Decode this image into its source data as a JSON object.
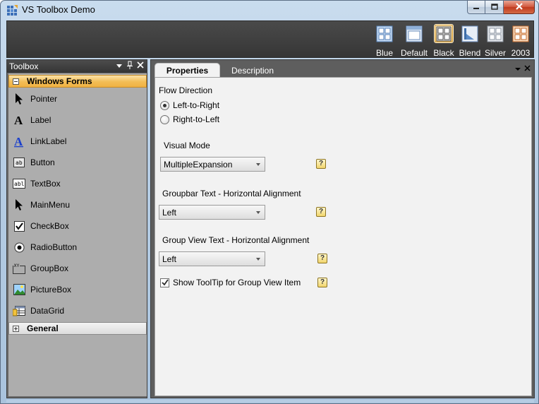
{
  "window": {
    "title": "VS Toolbox Demo"
  },
  "themes": [
    {
      "label": "Blue",
      "selected": false
    },
    {
      "label": "Default",
      "selected": false
    },
    {
      "label": "Black",
      "selected": true
    },
    {
      "label": "Blend",
      "selected": false
    },
    {
      "label": "Silver",
      "selected": false
    },
    {
      "label": "2003",
      "selected": false
    }
  ],
  "toolbox": {
    "title": "Toolbox",
    "groups": [
      {
        "label": "Windows Forms",
        "expanded": true,
        "items": [
          {
            "label": "Pointer",
            "icon": "pointer-icon"
          },
          {
            "label": "Label",
            "icon": "label-icon"
          },
          {
            "label": "LinkLabel",
            "icon": "linklabel-icon"
          },
          {
            "label": "Button",
            "icon": "button-icon"
          },
          {
            "label": "TextBox",
            "icon": "textbox-icon"
          },
          {
            "label": "MainMenu",
            "icon": "mainmenu-icon"
          },
          {
            "label": "CheckBox",
            "icon": "checkbox-icon"
          },
          {
            "label": "RadioButton",
            "icon": "radiobutton-icon"
          },
          {
            "label": "GroupBox",
            "icon": "groupbox-icon"
          },
          {
            "label": "PictureBox",
            "icon": "picturebox-icon"
          },
          {
            "label": "DataGrid",
            "icon": "datagrid-icon"
          }
        ]
      },
      {
        "label": "General",
        "expanded": false,
        "items": []
      }
    ]
  },
  "tabs": {
    "properties": "Properties",
    "description": "Description"
  },
  "properties": {
    "flow_direction": {
      "label": "Flow Direction",
      "options": [
        "Left-to-Right",
        "Right-to-Left"
      ],
      "selected": "Left-to-Right"
    },
    "visual_mode": {
      "label": "Visual Mode",
      "value": "MultipleExpansion"
    },
    "groupbar_text_alignment": {
      "label": "Groupbar Text - Horizontal Alignment",
      "value": "Left"
    },
    "groupview_text_alignment": {
      "label": "Group View Text - Horizontal Alignment",
      "value": "Left"
    },
    "show_tooltip": {
      "label": "Show ToolTip for Group View Item",
      "checked": true
    },
    "help_glyph": "?"
  },
  "colors": {
    "accent_orange": "#f3bd55",
    "dark_band": "#3e3e3e",
    "panel_gray": "#adadad"
  }
}
